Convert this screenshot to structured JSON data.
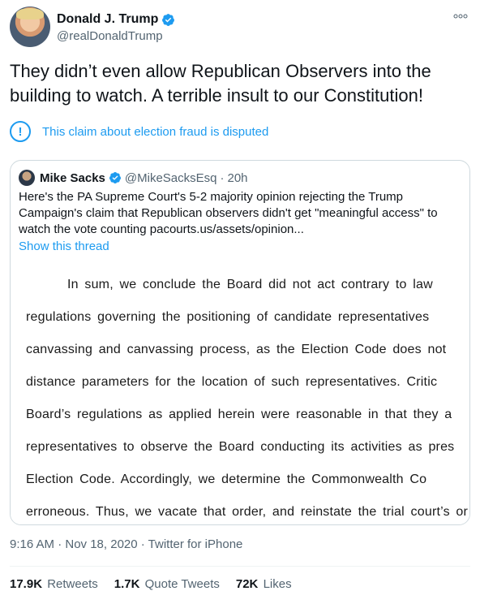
{
  "author": {
    "display_name": "Donald J. Trump",
    "handle": "@realDonaldTrump",
    "verified": true
  },
  "tweet": {
    "text": "They didn’t even allow Republican Observers into the building to watch. A terrible insult to our Constitution!",
    "claim_notice": "This claim about election fraud is disputed",
    "timestamp": "9:16 AM · Nov 18, 2020 · Twitter for iPhone"
  },
  "quoted_tweet": {
    "display_name": "Mike Sacks",
    "handle": "@MikeSacksEsq",
    "separator": "·",
    "time": "20h",
    "text": "Here's the PA Supreme Court's 5-2 majority opinion rejecting the Trump Campaign's claim that Republican observers didn't get \"meaningful access\" to watch the vote counting pacourts.us/assets/opinion...",
    "show_thread": "Show this thread",
    "document_lines": [
      "In sum, we conclude the Board did not act contrary to law",
      "regulations governing the positioning of candidate representatives",
      "canvassing and canvassing process, as the Election Code does not",
      "distance parameters for the location of such representatives.  Critic",
      "Board’s regulations as applied herein were reasonable in that they a",
      "representatives to observe the Board conducting its activities as pres",
      "Election Code.  Accordingly, we determine the Commonwealth Co",
      "erroneous.  Thus, we vacate that order, and reinstate the trial court’s or"
    ]
  },
  "stats": {
    "retweets_count": "17.9K",
    "retweets_label": "Retweets",
    "quotes_count": "1.7K",
    "quotes_label": "Quote Tweets",
    "likes_count": "72K",
    "likes_label": "Likes"
  },
  "colors": {
    "accent": "#1d9bf0",
    "text": "#0f1419",
    "secondary": "#536471",
    "border": "#cfd9de"
  },
  "icons": {
    "verified": "verified-badge-icon",
    "more": "more-options-icon",
    "notice": "exclamation-circle-icon"
  }
}
